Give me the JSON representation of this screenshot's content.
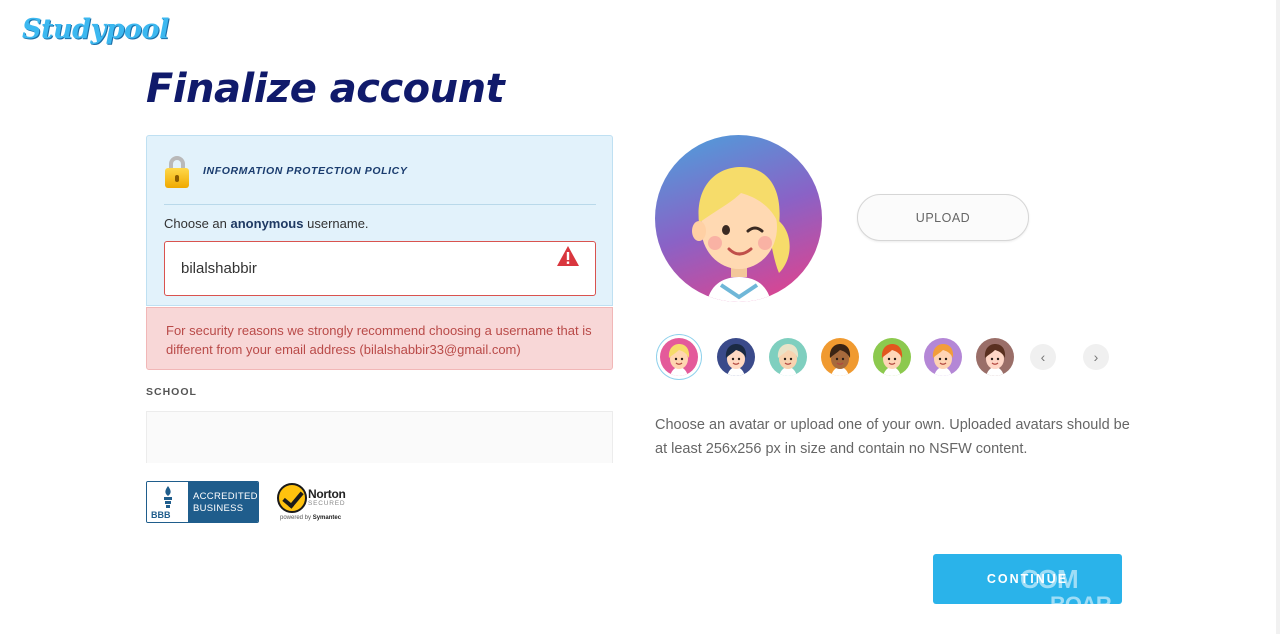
{
  "brand": {
    "logo_text": "Studypool"
  },
  "page": {
    "title": "Finalize account"
  },
  "policy": {
    "title": "INFORMATION PROTECTION POLICY",
    "choose_prefix": "Choose an",
    "choose_bold": "anonymous",
    "choose_suffix": "username.",
    "username_value": "bilalshabbir",
    "error_message": "For security reasons we strongly recommend choosing a username that is different from your email address (bilalshabbir33@gmail.com)"
  },
  "school": {
    "label": "SCHOOL",
    "value": ""
  },
  "badges": {
    "bbb_seal": "BBB",
    "bbb_line1": "ACCREDITED",
    "bbb_line2": "BUSINESS",
    "norton_name": "Norton",
    "norton_secured": "SECURED",
    "norton_powered_prefix": "powered by",
    "norton_powered_brand": "Symantec"
  },
  "avatar": {
    "upload_label": "UPLOAD",
    "note": "Choose an avatar or upload one of your own. Uploaded avatars should be at least 256x256 px in size and contain no NSFW content.",
    "prev_icon": "‹",
    "next_icon": "›",
    "thumbs": [
      {
        "name": "blonde-girl",
        "bg": "#e45a9a",
        "skin": "#ffd6b0",
        "hair": "#f6dc6a",
        "selected": true
      },
      {
        "name": "blue-hair",
        "bg": "#3a4a8a",
        "skin": "#ffd9c2",
        "hair": "#1b2a44",
        "selected": false
      },
      {
        "name": "cap-boy",
        "bg": "#7fcfbf",
        "skin": "#f8d3b0",
        "hair": "#e9e3c8",
        "selected": false
      },
      {
        "name": "curly-girl",
        "bg": "#f09a30",
        "skin": "#a66a3c",
        "hair": "#3a2414",
        "selected": false
      },
      {
        "name": "glasses-redhead",
        "bg": "#8cc94e",
        "skin": "#ffd6b8",
        "hair": "#e2571e",
        "selected": false
      },
      {
        "name": "orange-girl",
        "bg": "#b487d6",
        "skin": "#ffd4b4",
        "hair": "#f29d3a",
        "selected": false
      },
      {
        "name": "brunette-girl",
        "bg": "#9a6e68",
        "skin": "#ffd6c6",
        "hair": "#5a3020",
        "selected": false
      }
    ]
  },
  "actions": {
    "continue_label": "CONTINUE"
  },
  "watermark": {
    "line1": "COM",
    "line2": "BOAR"
  },
  "colors": {
    "accent": "#2ab3ea",
    "title": "#101a6b",
    "error_bg": "#f8d7d7",
    "policy_bg": "#e2f2fb"
  }
}
